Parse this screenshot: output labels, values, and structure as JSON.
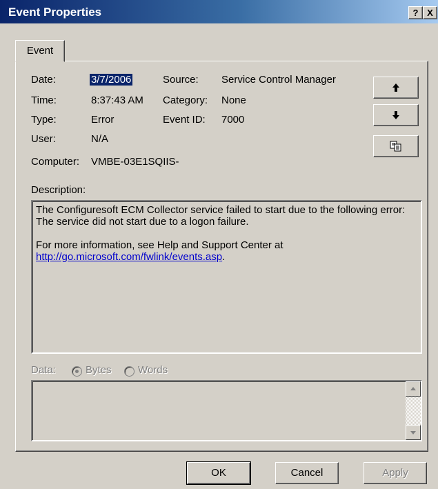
{
  "window": {
    "title": "Event Properties",
    "help_glyph": "?",
    "close_glyph": "X"
  },
  "tabs": [
    {
      "label": "Event"
    }
  ],
  "fields": {
    "date_label": "Date:",
    "date_value": "3/7/2006",
    "time_label": "Time:",
    "time_value": "8:37:43 AM",
    "type_label": "Type:",
    "type_value": "Error",
    "user_label": "User:",
    "user_value": "N/A",
    "computer_label": "Computer:",
    "computer_value": "VMBE-03E1SQIIS-",
    "source_label": "Source:",
    "source_value": "Service Control Manager",
    "category_label": "Category:",
    "category_value": "None",
    "eventid_label": "Event ID:",
    "eventid_value": "7000"
  },
  "side_buttons": {
    "up_icon": "arrow-up",
    "down_icon": "arrow-down",
    "copy_icon": "copy"
  },
  "description": {
    "label": "Description:",
    "line1": "The Configuresoft ECM Collector service failed to start due to the following error:",
    "line2": "The service did not start due to a logon failure.",
    "line3": "For more information, see Help and Support Center at",
    "link": "http://go.microsoft.com/fwlink/events.asp",
    "after_link": "."
  },
  "data_section": {
    "label": "Data:",
    "bytes_label": "Bytes",
    "words_label": "Words",
    "selected": "Bytes"
  },
  "footer": {
    "ok": "OK",
    "cancel": "Cancel",
    "apply": "Apply"
  },
  "colors": {
    "title_bar": "#0a246a",
    "face": "#d4d0c8",
    "link": "#0000cc",
    "selection": "#0a246a"
  }
}
